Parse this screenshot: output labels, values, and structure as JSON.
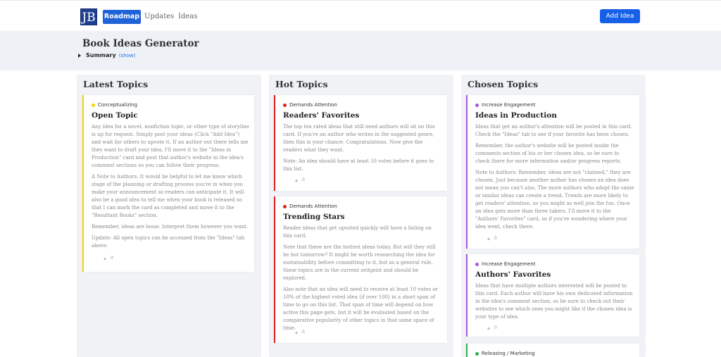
{
  "nav": {
    "logo": "JB",
    "active_tab": "Roadmap",
    "links": [
      "Updates",
      "Ideas"
    ],
    "add_button": "Add Idea"
  },
  "board": {
    "title": "Book Ideas Generator",
    "summary_label": "Summary",
    "summary_toggle": "(show)"
  },
  "colors": {
    "accent": "#1f63d8",
    "conceptualizing": "#f2d600",
    "demands_attention": "#e02020",
    "increase_engagement": "#a259d9",
    "releasing": "#2db24a"
  },
  "columns": [
    {
      "title": "Latest Topics",
      "cards": [
        {
          "tag": "Conceptualizing",
          "title": "Open Topic",
          "paragraphs": [
            "Any idea for a novel, nonfiction topic, or other type of storyline is up for request. Simply post your ideas (Click \"Add Idea\") and wait for others to upvote it. If an author out there tells me they want to draft your idea, I'll move it to the \"Ideas in Production\" card and post that author's website in the idea's comment sections so you can follow their progress.",
            "A Note to Authors: It would be helpful to let me know which stage of the planning or drafting process you're in when you make your announcement so readers can anticipate it. It will also be a good idea to tell me when your book is released so that I can mark the card as completed and move it to the \"Resultant Books\" section.",
            "Remember, ideas are loose. Interpret them however you want.",
            "Update: All open topics can be accessed from the \"Ideas\" tab above."
          ],
          "votes": "0"
        }
      ]
    },
    {
      "title": "Hot Topics",
      "cards": [
        {
          "tag": "Demands Attention",
          "title": "Readers' Favorites",
          "paragraphs": [
            "The top ten rated ideas that still need authors will sit on this card. If you're an author who writes in the suggested genre, then this is your chance. Congratulations. Now give the readers what they want.",
            "Note: An idea should have at least 10 votes before it goes to this list."
          ],
          "votes": "0"
        },
        {
          "tag": "Demands Attention",
          "title": "Trending Stars",
          "paragraphs": [
            "Reader ideas that get upvoted quickly will have a listing on this card.",
            "Note that these are the hottest ideas today. But will they still be hot tomorrow? It might be worth researching the idea for sustainability before committing to it, but as a general rule, these topics are in the current zeitgeist and should be explored.",
            "Also note that an idea will need to receive at least 10 votes or 10% of the highest voted idea (if over 100) in a short span of time to go on this list. That span of time will depend on how active this page gets, but it will be evaluated based on the comparative popularity of other topics in that same space of time."
          ],
          "votes": "0"
        }
      ]
    },
    {
      "title": "Chosen Topics",
      "cards": [
        {
          "tag": "Increase Engagement",
          "title": "Ideas in Production",
          "paragraphs": [
            "Ideas that get an author's attention will be posted in this card. Check the \"Ideas\" tab to see if your favorite has been chosen.",
            "Remember, the author's website will be posted inside the comments section of his or her chosen idea, so be sure to check there for more information and/or progress reports.",
            "Note to Authors: Remember, ideas are not \"claimed,\" they are chosen. Just because another author has chosen an idea does not mean you can't also. The more authors who adopt the same or similar ideas can create a trend. Trends are more likely to get readers' attention, so you might as well join the fun. Once an idea gets more than three takers, I'll move it to the \"Authors' Favorites\" card, so if you're wondering where your idea went, check there."
          ],
          "votes": "0"
        },
        {
          "tag": "Increase Engagement",
          "title": "Authors' Favorites",
          "paragraphs": [
            "Ideas that have multiple authors interested will be posted to this card. Each author will have his own dedicated information in the idea's comment section, so be sure to check out their websites to see which ones you might like if the chosen idea is your type of idea."
          ],
          "votes": "0"
        },
        {
          "tag": "Releasing / Marketing",
          "title": "",
          "paragraphs": [],
          "votes": ""
        }
      ]
    }
  ]
}
